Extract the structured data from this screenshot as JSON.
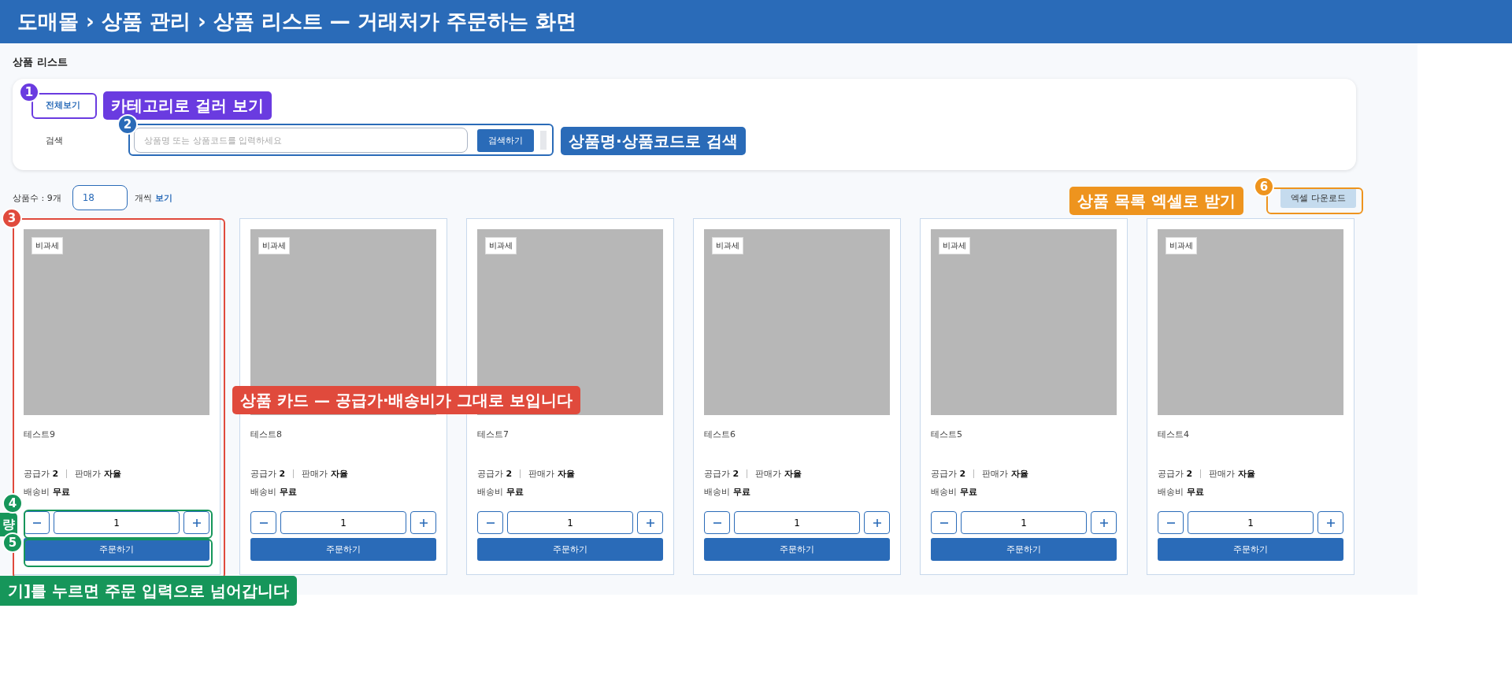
{
  "header": {
    "title": "도매몰 › 상품 관리 › 상품 리스트 — 거래처가 주문하는 화면"
  },
  "page_title": "상품 리스트",
  "filter": {
    "category": {
      "label": "전체보기",
      "selected": true
    },
    "search": {
      "label": "검색",
      "placeholder": "상품명 또는 상품코드를 입력하세요",
      "button": "검색하기"
    }
  },
  "list_bar": {
    "count": "상품수 : 9개",
    "per_page": "18",
    "per_page_label": "개씩",
    "per_page_link": "보기",
    "excel_button": "엑셀 다운로드"
  },
  "products": [
    {
      "badge": "비과세",
      "name": "테스트9",
      "supply_label": "공급가",
      "supply": "2",
      "sale_label": "판매가",
      "sale": "자율",
      "shipping_label": "배송비",
      "shipping": "무료",
      "qty": "1",
      "order": "주문하기"
    },
    {
      "badge": "비과세",
      "name": "테스트8",
      "supply_label": "공급가",
      "supply": "2",
      "sale_label": "판매가",
      "sale": "자율",
      "shipping_label": "배송비",
      "shipping": "무료",
      "qty": "1",
      "order": "주문하기"
    },
    {
      "badge": "비과세",
      "name": "테스트7",
      "supply_label": "공급가",
      "supply": "2",
      "sale_label": "판매가",
      "sale": "자율",
      "shipping_label": "배송비",
      "shipping": "무료",
      "qty": "1",
      "order": "주문하기"
    },
    {
      "badge": "비과세",
      "name": "테스트6",
      "supply_label": "공급가",
      "supply": "2",
      "sale_label": "판매가",
      "sale": "자율",
      "shipping_label": "배송비",
      "shipping": "무료",
      "qty": "1",
      "order": "주문하기"
    },
    {
      "badge": "비과세",
      "name": "테스트5",
      "supply_label": "공급가",
      "supply": "2",
      "sale_label": "판매가",
      "sale": "자율",
      "shipping_label": "배송비",
      "shipping": "무료",
      "qty": "1",
      "order": "주문하기"
    },
    {
      "badge": "비과세",
      "name": "테스트4",
      "supply_label": "공급가",
      "supply": "2",
      "sale_label": "판매가",
      "sale": "자율",
      "shipping_label": "배송비",
      "shipping": "무료",
      "qty": "1",
      "order": "주문하기"
    }
  ],
  "annotations": [
    {
      "number": "1",
      "text": "카테고리로 걸러 보기",
      "color": "#6a3be0"
    },
    {
      "number": "2",
      "text": "상품명·상품코드로 검색",
      "color": "#2a6bb8"
    },
    {
      "number": "3",
      "text": "상품 카드 — 공급가·배송비가 그대로 보입니다",
      "color": "#e04a3c"
    },
    {
      "number": "4",
      "text": "량",
      "color": "#16965a"
    },
    {
      "number": "5",
      "text": "기]를 누르면 주문 입력으로 넘어갑니다",
      "color": "#16965a"
    },
    {
      "number": "6",
      "text": "상품 목록 엑셀로 받기",
      "color": "#ee941e"
    }
  ]
}
